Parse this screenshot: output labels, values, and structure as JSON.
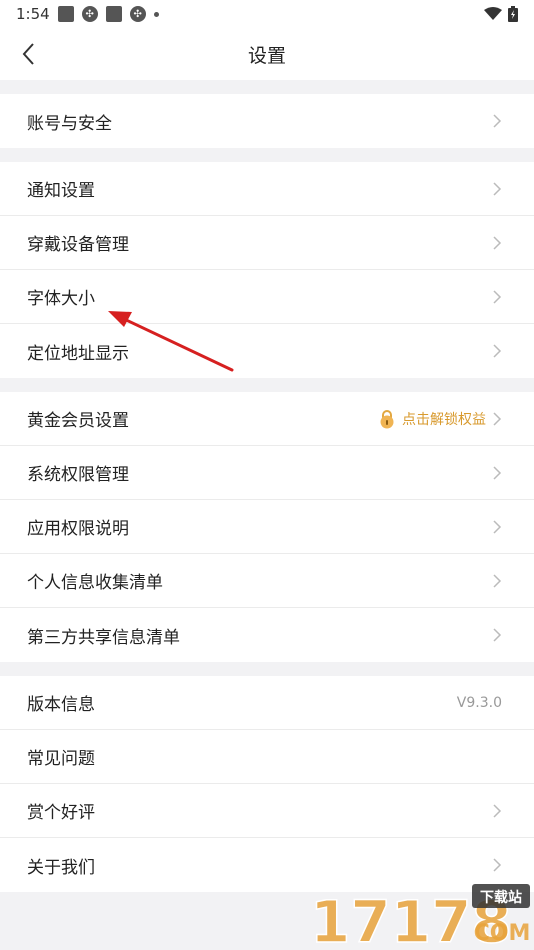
{
  "status_bar": {
    "time": "1:54"
  },
  "header": {
    "title": "设置"
  },
  "groups": [
    {
      "items": [
        {
          "label": "账号与安全"
        }
      ]
    },
    {
      "items": [
        {
          "label": "通知设置"
        },
        {
          "label": "穿戴设备管理"
        },
        {
          "label": "字体大小"
        },
        {
          "label": "定位地址显示"
        }
      ]
    },
    {
      "items": [
        {
          "label": "黄金会员设置",
          "promo": "点击解锁权益"
        },
        {
          "label": "系统权限管理"
        },
        {
          "label": "应用权限说明"
        },
        {
          "label": "个人信息收集清单"
        },
        {
          "label": "第三方共享信息清单"
        }
      ]
    },
    {
      "items": [
        {
          "label": "版本信息",
          "value": "V9.3.0"
        },
        {
          "label": "常见问题"
        },
        {
          "label": "赏个好评"
        },
        {
          "label": "关于我们"
        }
      ]
    }
  ],
  "watermark": {
    "text": "17178",
    "badge": "下载站",
    "suffix": "COM"
  },
  "colors": {
    "promo": "#d89a2e",
    "annotation_arrow": "#d62020",
    "watermark": "#e8a23a"
  }
}
